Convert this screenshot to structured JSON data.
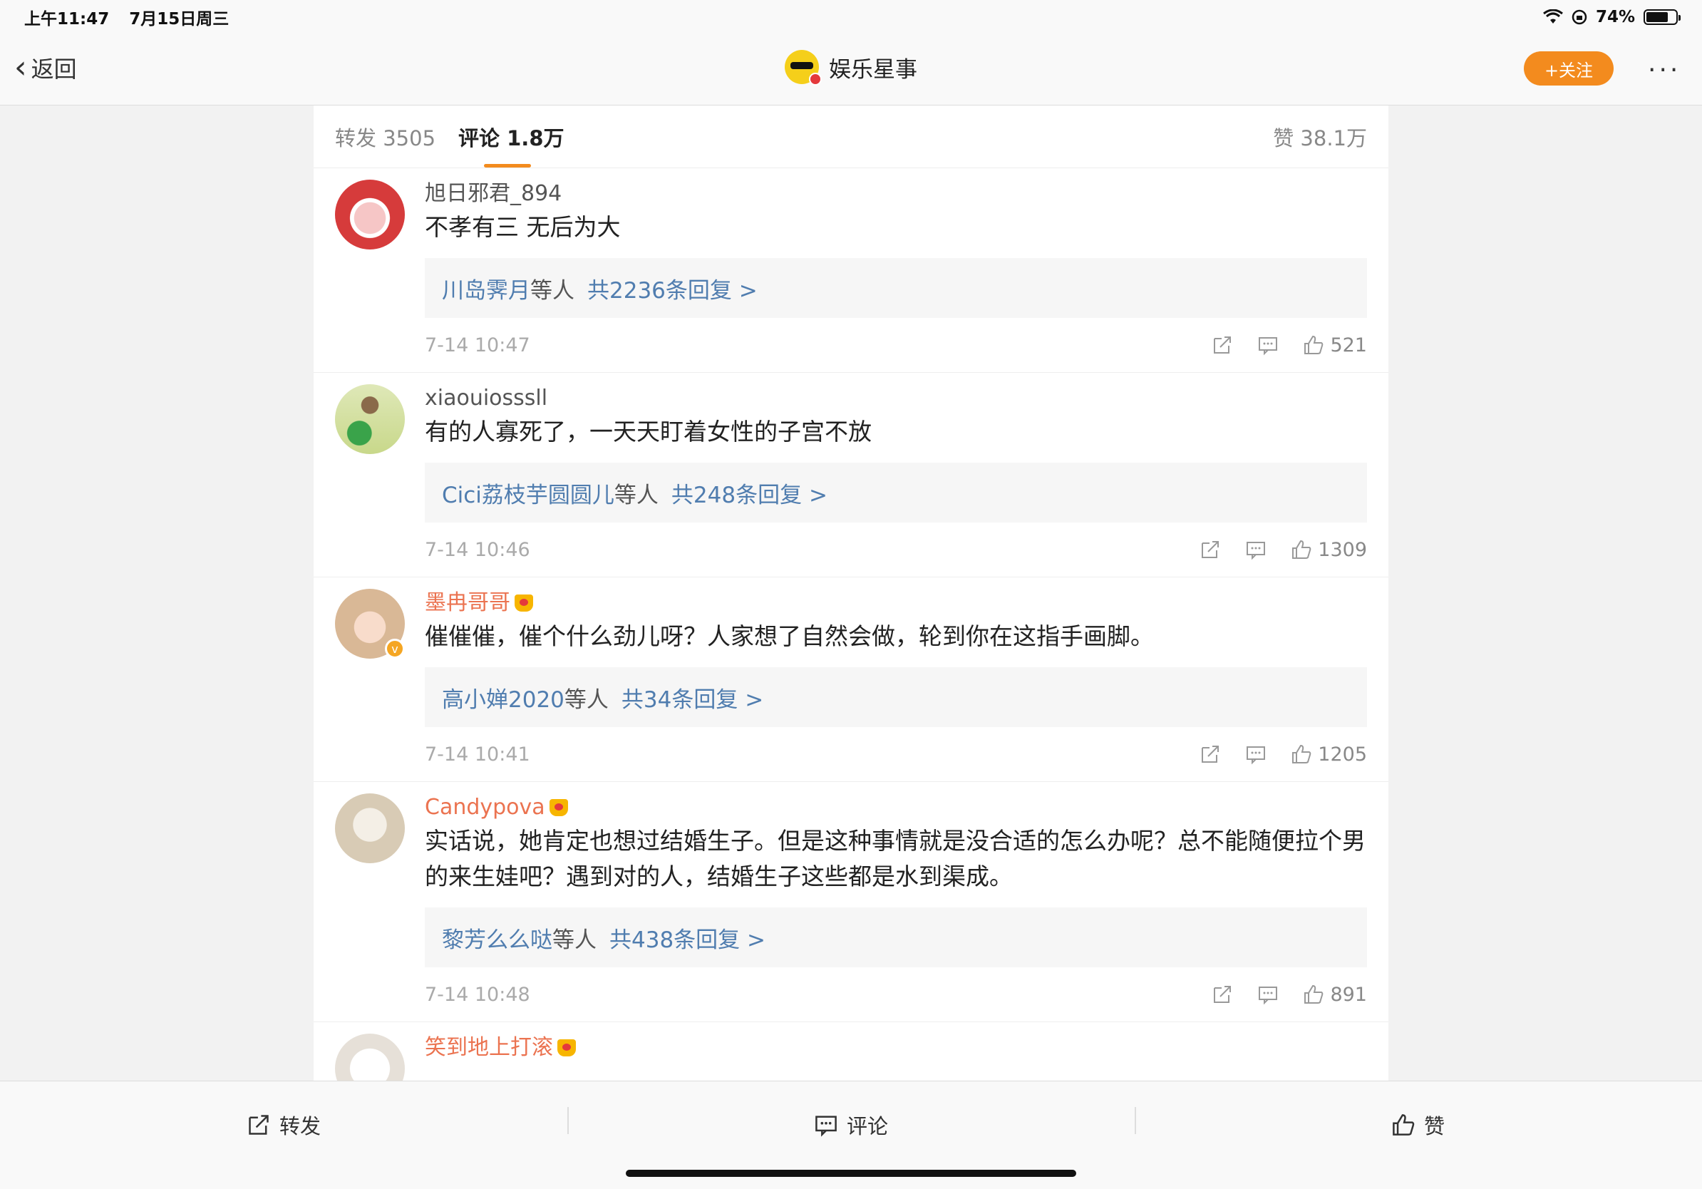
{
  "status_bar": {
    "time": "上午11:47",
    "date": "7月15日周三",
    "battery": "74%",
    "battery_level": 0.74
  },
  "nav": {
    "back_label": "返回",
    "title": "娱乐星事",
    "follow_label": "+关注",
    "more_label": "···"
  },
  "tabs": {
    "repost": "转发 3505",
    "comment": "评论 1.8万",
    "like": "赞 38.1万"
  },
  "comments": [
    {
      "name": "旭日邪君_894",
      "text": "不孝有三 无后为大",
      "reply_who": "川岛霁月",
      "reply_suffix": "等人",
      "reply_count": "共2236条回复 >",
      "time": "7-14 10:47",
      "likes": "521"
    },
    {
      "name": "xiaouiosssll",
      "text": "有的人寡死了，一天天盯着女性的子宫不放",
      "reply_who": "Cici荔枝芋圆圆儿",
      "reply_suffix": "等人",
      "reply_count": "共248条回复 >",
      "time": "7-14 10:46",
      "likes": "1309"
    },
    {
      "name": "墨冉哥哥",
      "text": "催催催，催个什么劲儿呀？人家想了自然会做，轮到你在这指手画脚。",
      "reply_who": "高小婵2020",
      "reply_suffix": "等人",
      "reply_count": "共34条回复 >",
      "time": "7-14 10:41",
      "likes": "1205"
    },
    {
      "name": "Candypova",
      "text": "实话说，她肯定也想过结婚生子。但是这种事情就是没合适的怎么办呢？总不能随便拉个男的来生娃吧？遇到对的人，结婚生子这些都是水到渠成。",
      "reply_who": "黎芳么么哒",
      "reply_suffix": "等人",
      "reply_count": "共438条回复 >",
      "time": "7-14 10:48",
      "likes": "891"
    },
    {
      "name": "笑到地上打滚"
    }
  ],
  "bottom_bar": {
    "repost": "转发",
    "comment": "评论",
    "like": "赞"
  },
  "colors": {
    "accent": "#f38b1e",
    "link": "#507daf",
    "vip_name": "#eb7350"
  }
}
